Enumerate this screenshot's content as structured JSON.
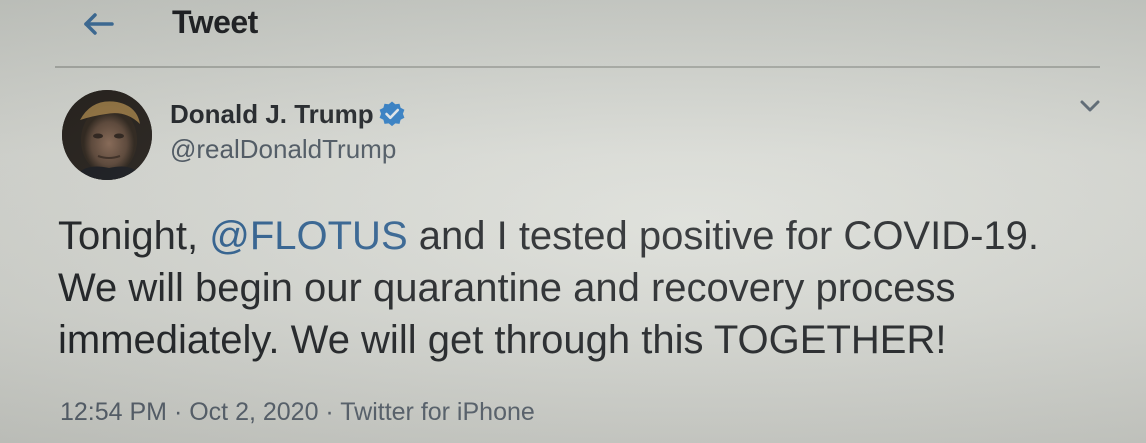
{
  "header": {
    "title": "Tweet",
    "back_icon": "arrow-left-icon"
  },
  "author": {
    "display_name": "Donald J. Trump",
    "handle": "@realDonaldTrump",
    "verified": true,
    "verified_color": "#1d9bf0",
    "avatar_icon": "profile-photo"
  },
  "menu": {
    "icon": "chevron-down-icon"
  },
  "tweet": {
    "line1_prefix": "Tonight, ",
    "mention": "@FLOTUS",
    "line1_suffix": " and I tested positive for COVID-19.",
    "line2": "We will begin our quarantine and recovery process",
    "line3": "immediately. We will get through this TOGETHER!"
  },
  "meta": {
    "time": "12:54 PM",
    "separator": " · ",
    "date": "Oct 2, 2020",
    "source": "Twitter for iPhone"
  },
  "colors": {
    "link": "#2a5d8f",
    "text": "#1c1f22",
    "muted": "#56606b"
  }
}
